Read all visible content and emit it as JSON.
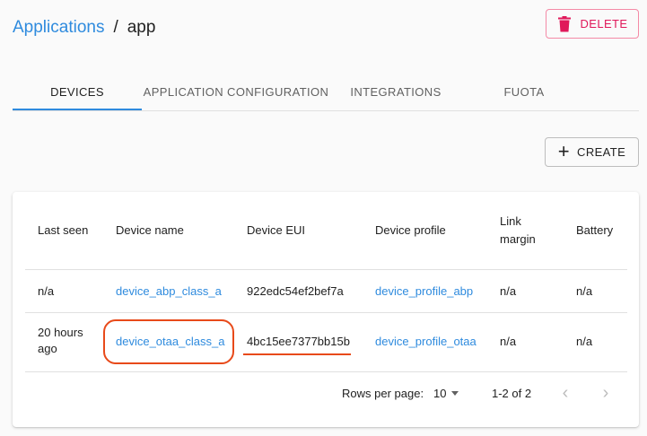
{
  "breadcrumb": {
    "parent": "Applications",
    "separator": "/",
    "current": "app"
  },
  "actions": {
    "delete_label": "DELETE",
    "create_label": "CREATE",
    "delete_icon": "trash-icon",
    "create_icon": "plus-icon"
  },
  "tabs": [
    {
      "label": "DEVICES",
      "active": true
    },
    {
      "label": "APPLICATION CONFIGURATION",
      "active": false
    },
    {
      "label": "INTEGRATIONS",
      "active": false
    },
    {
      "label": "FUOTA",
      "active": false
    }
  ],
  "table": {
    "columns": [
      "Last seen",
      "Device name",
      "Device EUI",
      "Device profile",
      "Link margin",
      "Battery"
    ],
    "rows": [
      {
        "last_seen": "n/a",
        "device_name": "device_abp_class_a",
        "device_eui": "922edc54ef2bef7a",
        "device_profile": "device_profile_abp",
        "link_margin": "n/a",
        "battery": "n/a"
      },
      {
        "last_seen": "20 hours ago",
        "device_name": "device_otaa_class_a",
        "device_eui": "4bc15ee7377bb15b",
        "device_profile": "device_profile_otaa",
        "link_margin": "n/a",
        "battery": "n/a"
      }
    ]
  },
  "pagination": {
    "rows_per_page_label": "Rows per page:",
    "rows_per_page": "10",
    "range": "1-2 of 2",
    "prev_icon": "chevron-left-icon",
    "next_icon": "chevron-right-icon"
  },
  "colors": {
    "accent": "#2f8bde",
    "danger": "#e0185a",
    "annotation": "#e84a1a"
  }
}
